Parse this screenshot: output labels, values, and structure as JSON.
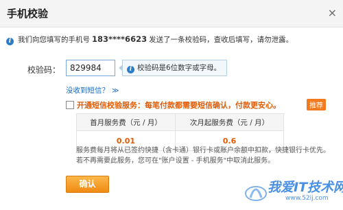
{
  "header": {
    "title": "手机校验",
    "close_label": "×"
  },
  "notice": {
    "prefix": "我们向您填写的手机号",
    "phone": "183****6623",
    "suffix": "发送了一条校验码，查收后填写，请勿泄露。"
  },
  "form": {
    "code_label": "校验码：",
    "code_value": "829984",
    "hint": "校验码是6位数字或字母。",
    "no_sms_link": "没收到短信？",
    "no_sms_chevron": "≫"
  },
  "promo": {
    "text": "开通短信校验服务：每笔付款都需要短信确认，付款更安心。",
    "badge": "推荐"
  },
  "fees": {
    "headers": [
      "首月服务费（元 / 月）",
      "次月起服务费（元 / 月）"
    ],
    "values": [
      "0.01",
      "0.6"
    ]
  },
  "description": {
    "line1": "服务费每月将从已签约快捷（含卡通）银行卡或账户余额中扣款，快捷银行卡优先。",
    "line2": "若不再需要此服务，您可在\"账户设置 - 手机服务\"中取消此服务。"
  },
  "confirm_button": "确认",
  "watermark": {
    "text": "我爱IT技术网",
    "url": "www.52ij.com"
  },
  "colors": {
    "accent": "#f08a12",
    "link": "#1a6bbf",
    "promo": "#e45a00",
    "info": "#2c7cc9"
  },
  "icons": {
    "info": "info-icon",
    "close": "close-icon",
    "chevron": "chevron-down-icon"
  }
}
